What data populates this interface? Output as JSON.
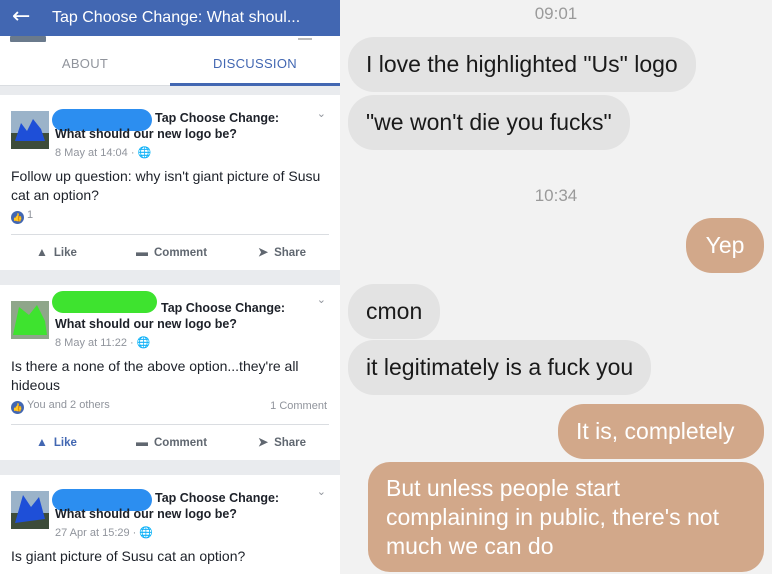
{
  "header": {
    "back_icon": "arrow-left-icon",
    "title": "Tap Choose Change: What shoul..."
  },
  "tabs": [
    {
      "label": "ABOUT"
    },
    {
      "label": "DISCUSSION"
    }
  ],
  "colors": {
    "fb_blue": "#4267b2",
    "chat_bg": "#f2f2f2",
    "incoming_bubble": "#e3e3e3",
    "outgoing_bubble": "#d2a88a"
  },
  "posts": [
    {
      "page_name": "Tap Choose Change:",
      "title": "What should our new logo be?",
      "meta": "8 May at 14:04 · 🌐",
      "text": "Follow up question: why isn't giant picture of Susu cat an option?",
      "reactions": "1",
      "comments": "",
      "actions": {
        "like": "Like",
        "comment": "Comment",
        "share": "Share"
      }
    },
    {
      "page_name": "Tap Choose Change:",
      "title": "What should our new logo be?",
      "meta": "8 May at 11:22 · 🌐",
      "text": "Is there a none of the above option...they're all hideous",
      "reactions": "You and 2 others",
      "comments": "1 Comment",
      "actions": {
        "like": "Like",
        "comment": "Comment",
        "share": "Share"
      }
    },
    {
      "page_name": "Tap Choose Change:",
      "title": "What should our new logo be?",
      "meta": "27 Apr at 15:29 · 🌐",
      "text": "Is giant picture of Susu cat an option?"
    }
  ],
  "chat": {
    "time_1": "09:01",
    "msg_1": "I love the highlighted \"Us\" logo",
    "msg_2": "\"we won't die you fucks\"",
    "time_2": "10:34",
    "msg_3": "Yep",
    "msg_4": "cmon",
    "msg_5": "it legitimately is a fuck you",
    "msg_6": "It is, completely",
    "msg_7": "But unless people start complaining in public, there's not much we can do"
  }
}
